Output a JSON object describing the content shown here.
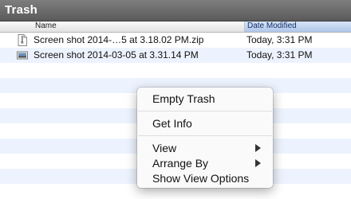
{
  "window": {
    "title": "Trash"
  },
  "columns": {
    "name": "Name",
    "date_modified": "Date Modified"
  },
  "files": [
    {
      "icon": "zip-file-icon",
      "name": "Screen shot 2014-…5 at 3.18.02 PM.zip",
      "date": "Today, 3:31 PM"
    },
    {
      "icon": "screenshot-file-icon",
      "name": "Screen shot 2014-03-05 at 3.31.14 PM",
      "date": "Today, 3:31 PM"
    }
  ],
  "context_menu": {
    "items": [
      {
        "label": "Empty Trash"
      },
      {
        "label": "Get Info"
      },
      {
        "label": "View",
        "submenu": true
      },
      {
        "label": "Arrange By",
        "submenu": true
      },
      {
        "label": "Show View Options"
      }
    ]
  },
  "colors": {
    "row_alt": "#edf3fe",
    "header_selected": "#aec6ea",
    "titlebar": "#6b6b6b"
  }
}
